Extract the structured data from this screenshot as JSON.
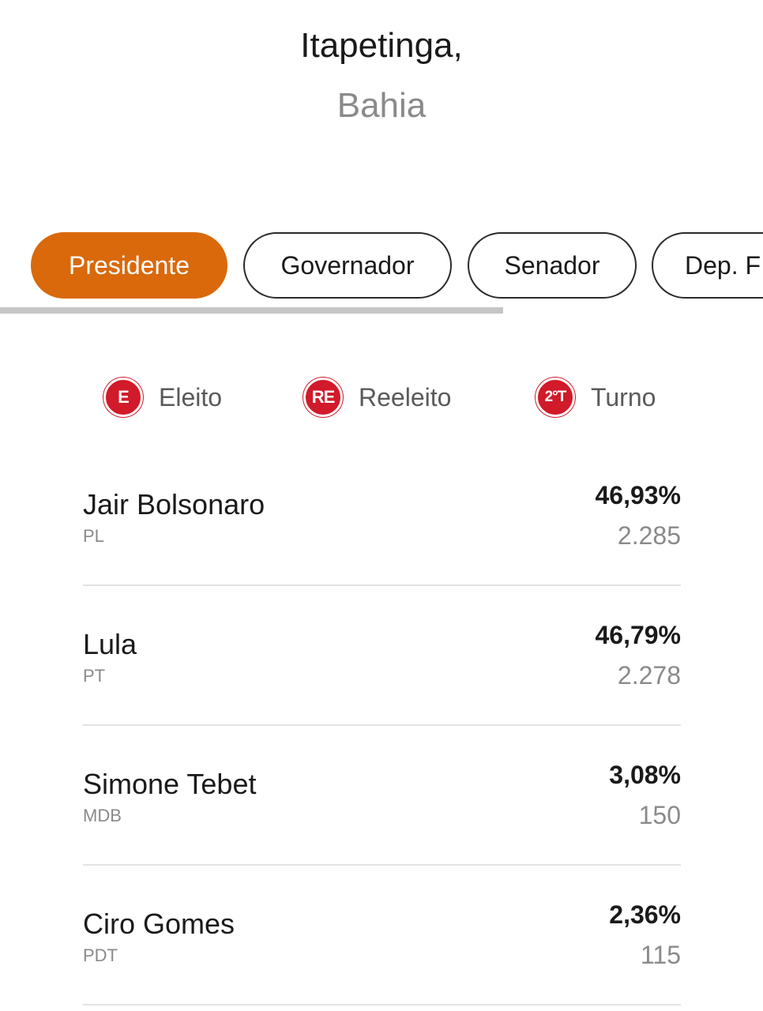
{
  "location": {
    "city": "Itapetinga,",
    "state": "Bahia"
  },
  "tabs": [
    {
      "label": "Presidente",
      "active": true
    },
    {
      "label": "Governador",
      "active": false
    },
    {
      "label": "Senador",
      "active": false
    },
    {
      "label": "Dep. F",
      "active": false
    }
  ],
  "legend": [
    {
      "badge": "E",
      "label": "Eleito"
    },
    {
      "badge": "RE",
      "label": "Reeleito"
    },
    {
      "badge": "2°T",
      "label": "Turno"
    }
  ],
  "candidates": [
    {
      "name": "Jair Bolsonaro",
      "party": "PL",
      "percent": "46,93%",
      "votes": "2.285"
    },
    {
      "name": "Lula",
      "party": "PT",
      "percent": "46,79%",
      "votes": "2.278"
    },
    {
      "name": "Simone Tebet",
      "party": "MDB",
      "percent": "3,08%",
      "votes": "150"
    },
    {
      "name": "Ciro Gomes",
      "party": "PDT",
      "percent": "2,36%",
      "votes": "115"
    }
  ],
  "colors": {
    "accent": "#d9690a",
    "badge": "#d11a2a"
  }
}
